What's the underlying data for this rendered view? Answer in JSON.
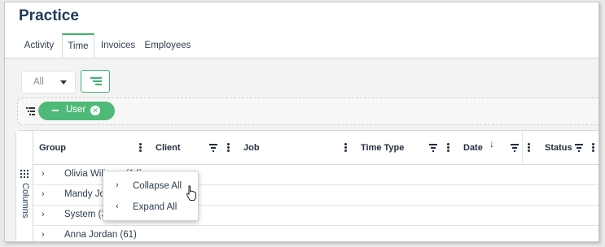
{
  "page": {
    "title": "Practice"
  },
  "tabs": [
    {
      "label": "Activity",
      "active": false
    },
    {
      "label": "Time",
      "active": true
    },
    {
      "label": "Invoices",
      "active": false
    },
    {
      "label": "Employees",
      "active": false
    }
  ],
  "toolbar": {
    "filter_value": "All",
    "group_button_icon": "group-rows-icon"
  },
  "group_panel": {
    "chip_label": "User"
  },
  "grid": {
    "side_panel_label": "Columns",
    "columns": [
      {
        "label": "Group"
      },
      {
        "label": "Client"
      },
      {
        "label": "Job"
      },
      {
        "label": "Time Type"
      },
      {
        "label": "Date"
      },
      {
        "label": "Status"
      }
    ],
    "rows": [
      {
        "label": "Olivia Wiliams (14)"
      },
      {
        "label": "Mandy Jones"
      },
      {
        "label": "System (35)"
      },
      {
        "label": "Anna Jordan (61)"
      }
    ]
  },
  "context_menu": {
    "items": [
      {
        "label": "Collapse All"
      },
      {
        "label": "Expand All"
      }
    ]
  },
  "colors": {
    "accent": "#3cb371",
    "chip": "#4fba78",
    "title": "#1f3a5a"
  }
}
